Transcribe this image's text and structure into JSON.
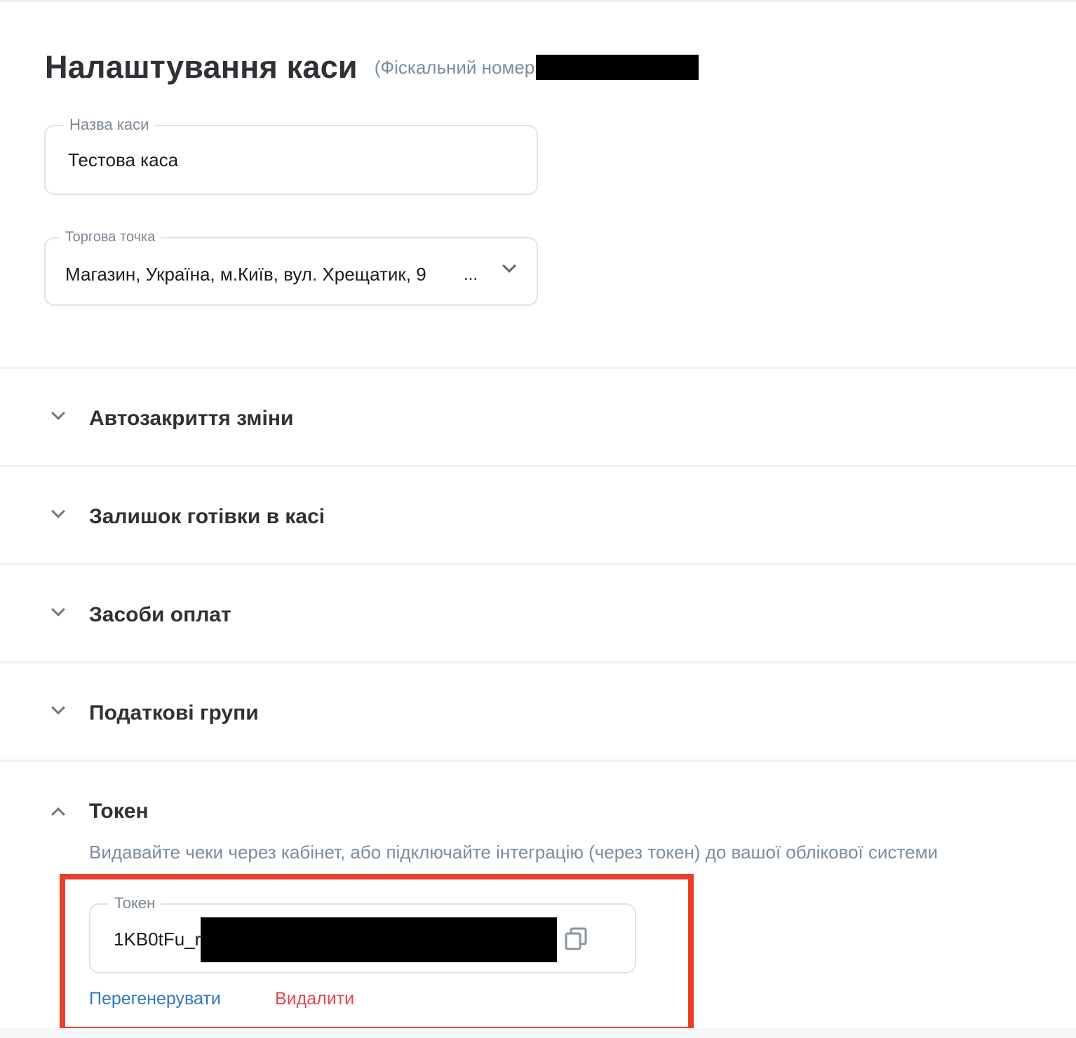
{
  "header": {
    "title": "Налаштування каси",
    "fiscal_label": "(Фіскальний номер"
  },
  "cash_name_field": {
    "label": "Назва каси",
    "value": "Тестова каса"
  },
  "shop_field": {
    "label": "Торгова точка",
    "value": "Магазин, Україна, м.Київ, вул. Хрещатик, 9",
    "ellipsis": "..."
  },
  "sections": [
    {
      "title": "Автозакриття зміни",
      "expanded": false
    },
    {
      "title": "Залишок готівки в касі",
      "expanded": false
    },
    {
      "title": "Засоби оплат",
      "expanded": false
    },
    {
      "title": "Податкові групи",
      "expanded": false
    },
    {
      "title": "Токен",
      "expanded": true
    }
  ],
  "token_section": {
    "description": "Видавайте чеки через кабінет, або підключайте інтеграцію (через токен) до вашої облікової системи",
    "field_label": "Токен",
    "value_visible": "1KB0tFu_r",
    "regenerate_label": "Перегенерувати",
    "delete_label": "Видалити"
  },
  "icons": {
    "copy": "copy-icon",
    "chevron": "chevron-down-icon"
  },
  "colors": {
    "highlight_border": "#e8412b",
    "link_blue": "#2f79c0",
    "link_red": "#e0474c",
    "muted_text": "#7a8c9e"
  }
}
